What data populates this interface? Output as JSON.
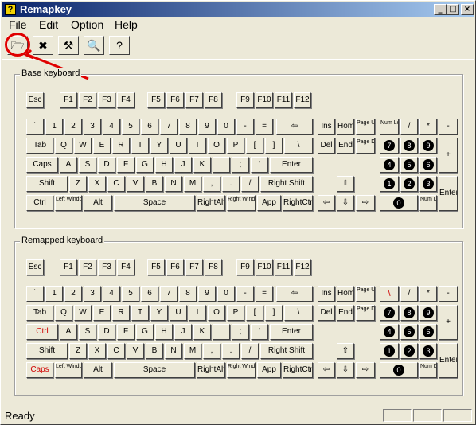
{
  "window": {
    "title": "Remapkey",
    "app_icon_glyph": "?",
    "minimize_glyph": "_",
    "maximize_glyph": "□",
    "close_glyph": "×"
  },
  "menu": {
    "file": "File",
    "edit": "Edit",
    "option": "Option",
    "help": "Help"
  },
  "toolbar": {
    "tools": [
      {
        "name": "open-icon",
        "glyph": "🗁"
      },
      {
        "name": "clear-icon",
        "glyph": "✖"
      },
      {
        "name": "remap-icon",
        "glyph": "⚒"
      },
      {
        "name": "preview-icon",
        "glyph": "🔍"
      },
      {
        "name": "help-icon",
        "glyph": "?"
      }
    ],
    "annotation_color": "#e00000"
  },
  "base_keyboard": {
    "label": "Base keyboard"
  },
  "remapped_keyboard": {
    "label": "Remapped keyboard"
  },
  "status": {
    "text": "Ready"
  },
  "keys": {
    "esc": "Esc",
    "f1": "F1",
    "f2": "F2",
    "f3": "F3",
    "f4": "F4",
    "f5": "F5",
    "f6": "F6",
    "f7": "F7",
    "f8": "F8",
    "f9": "F9",
    "f10": "F10",
    "f11": "F11",
    "f12": "F12",
    "backtick": "`",
    "n1": "1",
    "n2": "2",
    "n3": "3",
    "n4": "4",
    "n5": "5",
    "n6": "6",
    "n7": "7",
    "n8": "8",
    "n9": "9",
    "n0": "0",
    "minus": "-",
    "equals": "=",
    "backspace": "⇦",
    "tab": "Tab",
    "q": "Q",
    "w": "W",
    "e": "E",
    "r": "R",
    "t": "T",
    "y": "Y",
    "u": "U",
    "i": "I",
    "o": "O",
    "p": "P",
    "lbracket": "[",
    "rbracket": "]",
    "backslash": "\\",
    "caps": "Caps",
    "ctrl": "Ctrl",
    "a": "A",
    "s": "S",
    "d": "D",
    "f": "F",
    "g": "G",
    "h": "H",
    "j": "J",
    "k": "K",
    "l": "L",
    "semicolon": ";",
    "quote": "'",
    "enter": "Enter",
    "shift": "Shift",
    "z": "Z",
    "x": "X",
    "c": "C",
    "v": "V",
    "b": "B",
    "n": "N",
    "m": "M",
    "comma": ",",
    "period": ".",
    "slash": "/",
    "rshift": "Right Shift",
    "lwin": "Left Windows",
    "alt": "Alt",
    "space": "Space",
    "ralt": "RightAlt",
    "rwin": "Right Windows",
    "app": "App",
    "rctrl": "RightCtrl",
    "ins": "Ins",
    "home": "Home",
    "pgup": "Page Up",
    "del": "Del",
    "end": "End",
    "pgdn": "Page Down",
    "up": "⇧",
    "left": "⇦",
    "down": "⇩",
    "right": "⇨",
    "numlock": "Num Lock",
    "ndiv": "/",
    "nmul": "*",
    "nsub": "-",
    "nadd": "+",
    "nenter": "Enter",
    "np7": "7",
    "np8": "8",
    "np9": "9",
    "np4": "4",
    "np5": "5",
    "np6": "6",
    "np1": "1",
    "np2": "2",
    "np3": "3",
    "np0": "0",
    "numdel": "Num Del"
  }
}
